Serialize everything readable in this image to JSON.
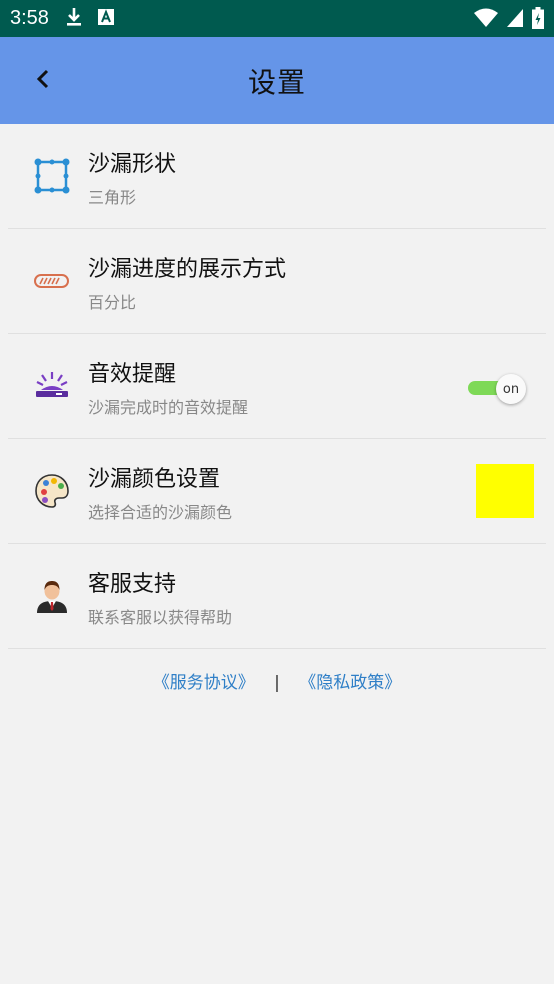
{
  "status_bar": {
    "time": "3:58",
    "icons": [
      "download-icon",
      "a-notification-icon",
      "wifi-icon",
      "signal-icon",
      "battery-icon"
    ]
  },
  "app_bar": {
    "title": "设置",
    "back_icon": "back-arrow-icon",
    "background": "#6595e8"
  },
  "settings": [
    {
      "icon": "shape-icon",
      "title": "沙漏形状",
      "subtitle": "三角形"
    },
    {
      "icon": "progress-icon",
      "title": "沙漏进度的展示方式",
      "subtitle": "百分比"
    },
    {
      "icon": "sound-alert-icon",
      "title": "音效提醒",
      "subtitle": "沙漏完成时的音效提醒",
      "toggle": "on"
    },
    {
      "icon": "palette-icon",
      "title": "沙漏颜色设置",
      "subtitle": "选择合适的沙漏颜色",
      "swatch_color": "#ffff00"
    },
    {
      "icon": "support-agent-icon",
      "title": "客服支持",
      "subtitle": "联系客服以获得帮助"
    }
  ],
  "footer": {
    "service_link": "《服务协议》",
    "separator": "|",
    "privacy_link": "《隐私政策》"
  }
}
